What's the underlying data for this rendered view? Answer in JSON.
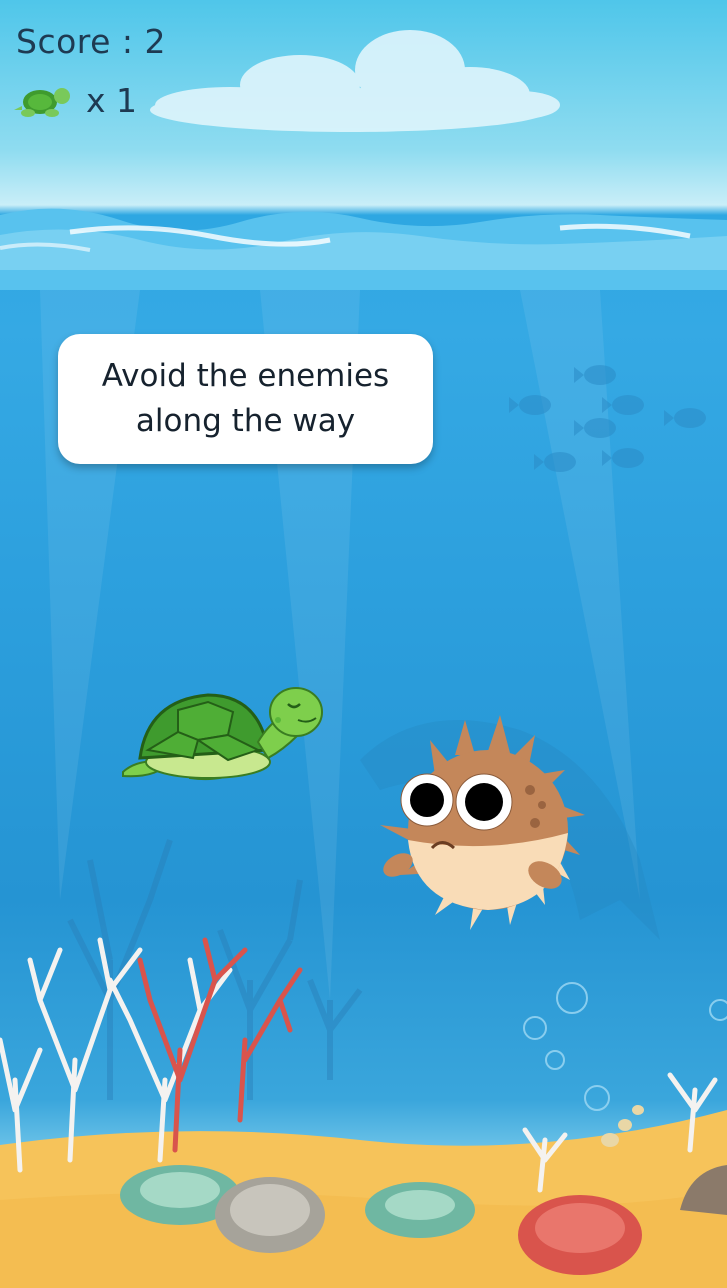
{
  "hud": {
    "score_text": "Score : 2",
    "lives_text": "x 1",
    "lives_icon": "turtle-icon"
  },
  "tutorial": {
    "message": "Avoid the enemies\nalong the way"
  },
  "scene": {
    "player": "sea-turtle",
    "enemy": "pufferfish",
    "colors": {
      "sky": "#4fc6ea",
      "water": "#2ea7e2",
      "sand": "#f6c35a",
      "hud_text": "#1e3a52"
    }
  }
}
